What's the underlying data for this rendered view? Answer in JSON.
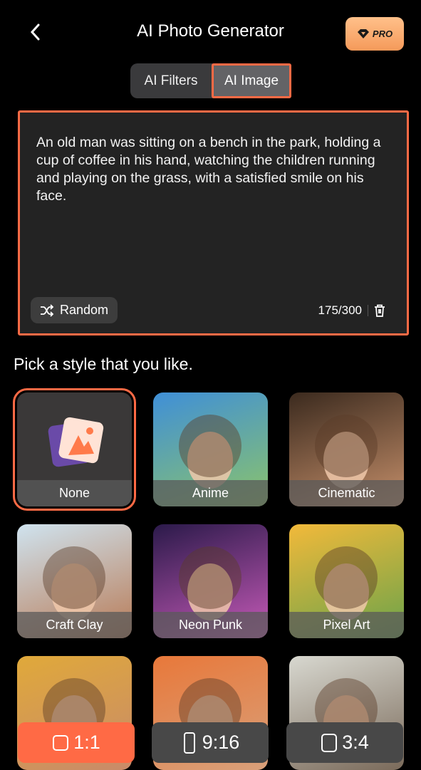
{
  "header": {
    "title": "AI Photo Generator",
    "pro_label": "PRO"
  },
  "tabs": [
    {
      "label": "AI Filters",
      "active": false
    },
    {
      "label": "AI Image",
      "active": true
    }
  ],
  "prompt": {
    "text": "An old man was sitting on a bench in the park, holding a cup of coffee in his hand, watching the children running and playing on the grass, with a satisfied smile on his face.",
    "random_label": "Random",
    "count": "175/300"
  },
  "styles_heading": "Pick a style that you like.",
  "styles": [
    {
      "label": "None",
      "selected": true,
      "colors": [
        "#3a3838",
        "#3a3838"
      ]
    },
    {
      "label": "Anime",
      "selected": false,
      "colors": [
        "#3f8fd8",
        "#8cc46a"
      ]
    },
    {
      "label": "Cinematic",
      "selected": false,
      "colors": [
        "#3b2a1e",
        "#c58f6a"
      ]
    },
    {
      "label": "Craft Clay",
      "selected": false,
      "colors": [
        "#cfe3ef",
        "#b87a55"
      ]
    },
    {
      "label": "Neon Punk",
      "selected": false,
      "colors": [
        "#2b1a4a",
        "#c65ab8"
      ]
    },
    {
      "label": "Pixel Art",
      "selected": false,
      "colors": [
        "#f2b93a",
        "#6aa34a"
      ]
    },
    {
      "label": "",
      "selected": false,
      "colors": [
        "#e0a93a",
        "#c88a6a"
      ]
    },
    {
      "label": "",
      "selected": false,
      "colors": [
        "#e8783a",
        "#d9a07a"
      ]
    },
    {
      "label": "",
      "selected": false,
      "colors": [
        "#d8d8d0",
        "#7a6a5a"
      ]
    }
  ],
  "ratios": [
    {
      "label": "1:1",
      "active": true
    },
    {
      "label": "9:16",
      "active": false
    },
    {
      "label": "3:4",
      "active": false
    }
  ],
  "colors": {
    "accent": "#ff6a45",
    "pro": "#f7a96b"
  }
}
